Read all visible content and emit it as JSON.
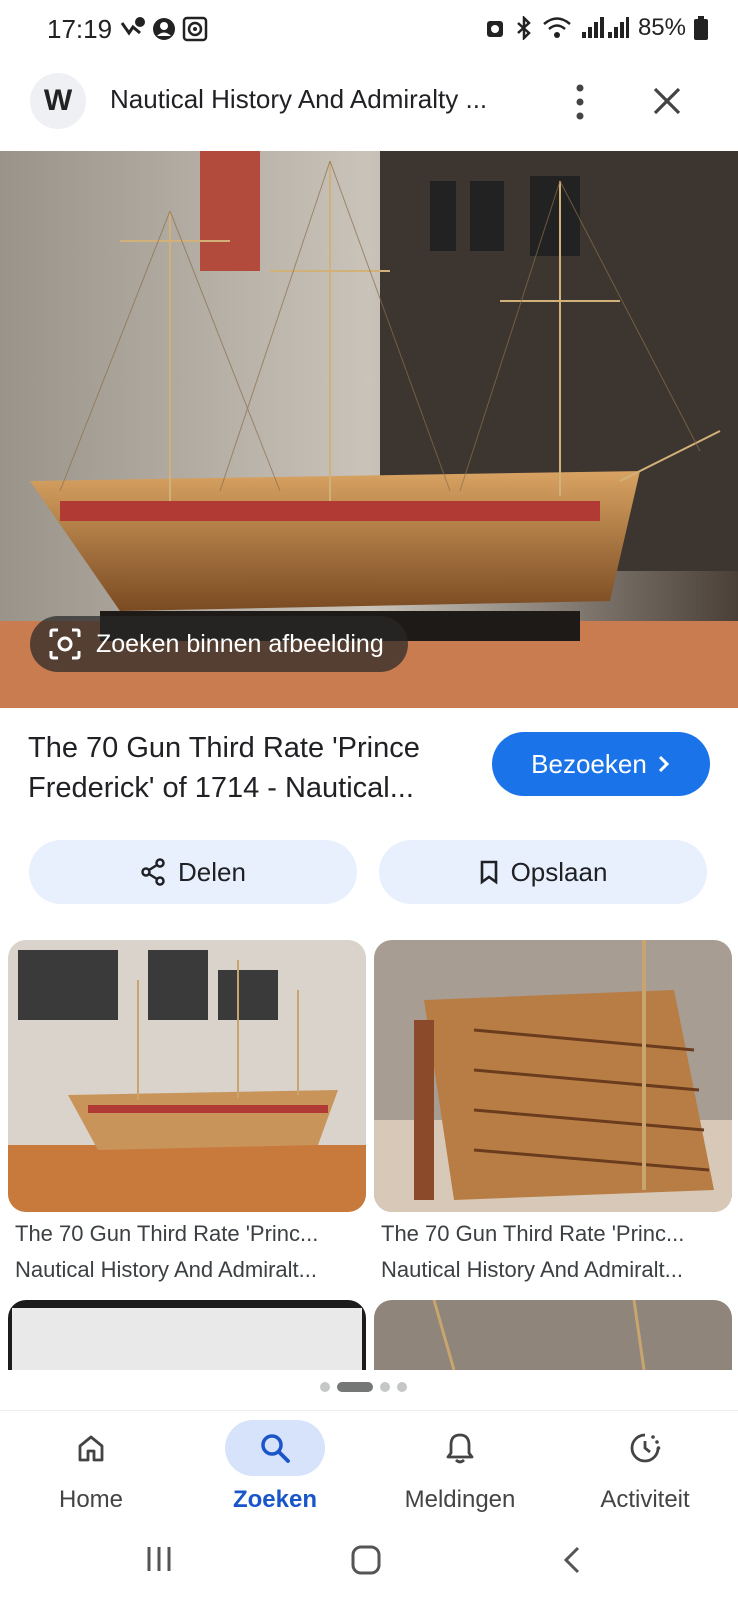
{
  "status_bar": {
    "time": "17:19",
    "battery": "85%"
  },
  "header": {
    "site_title": "Nautical History And Admiralty ...",
    "logo_letter": "W"
  },
  "image": {
    "lens_label": "Zoeken binnen afbeelding"
  },
  "result": {
    "title_line1": "The 70 Gun Third Rate 'Prince",
    "title_line2": "Frederick' of 1714 - Nautical...",
    "visit_label": "Bezoeken",
    "share_label": "Delen",
    "save_label": "Opslaan"
  },
  "related": [
    {
      "title": "The 70 Gun Third Rate 'Princ...",
      "source": "Nautical History And Admiralt..."
    },
    {
      "title": "The 70 Gun Third Rate 'Princ...",
      "source": "Nautical History And Admiralt..."
    }
  ],
  "bottom_nav": [
    {
      "label": "Home",
      "icon": "home-icon"
    },
    {
      "label": "Zoeken",
      "icon": "search-icon",
      "active": true
    },
    {
      "label": "Meldingen",
      "icon": "bell-icon"
    },
    {
      "label": "Activiteit",
      "icon": "activity-icon"
    }
  ],
  "colors": {
    "accent": "#1a73e8",
    "pill_bg": "#e8f0fe",
    "active_nav": "#d7e3fb"
  }
}
